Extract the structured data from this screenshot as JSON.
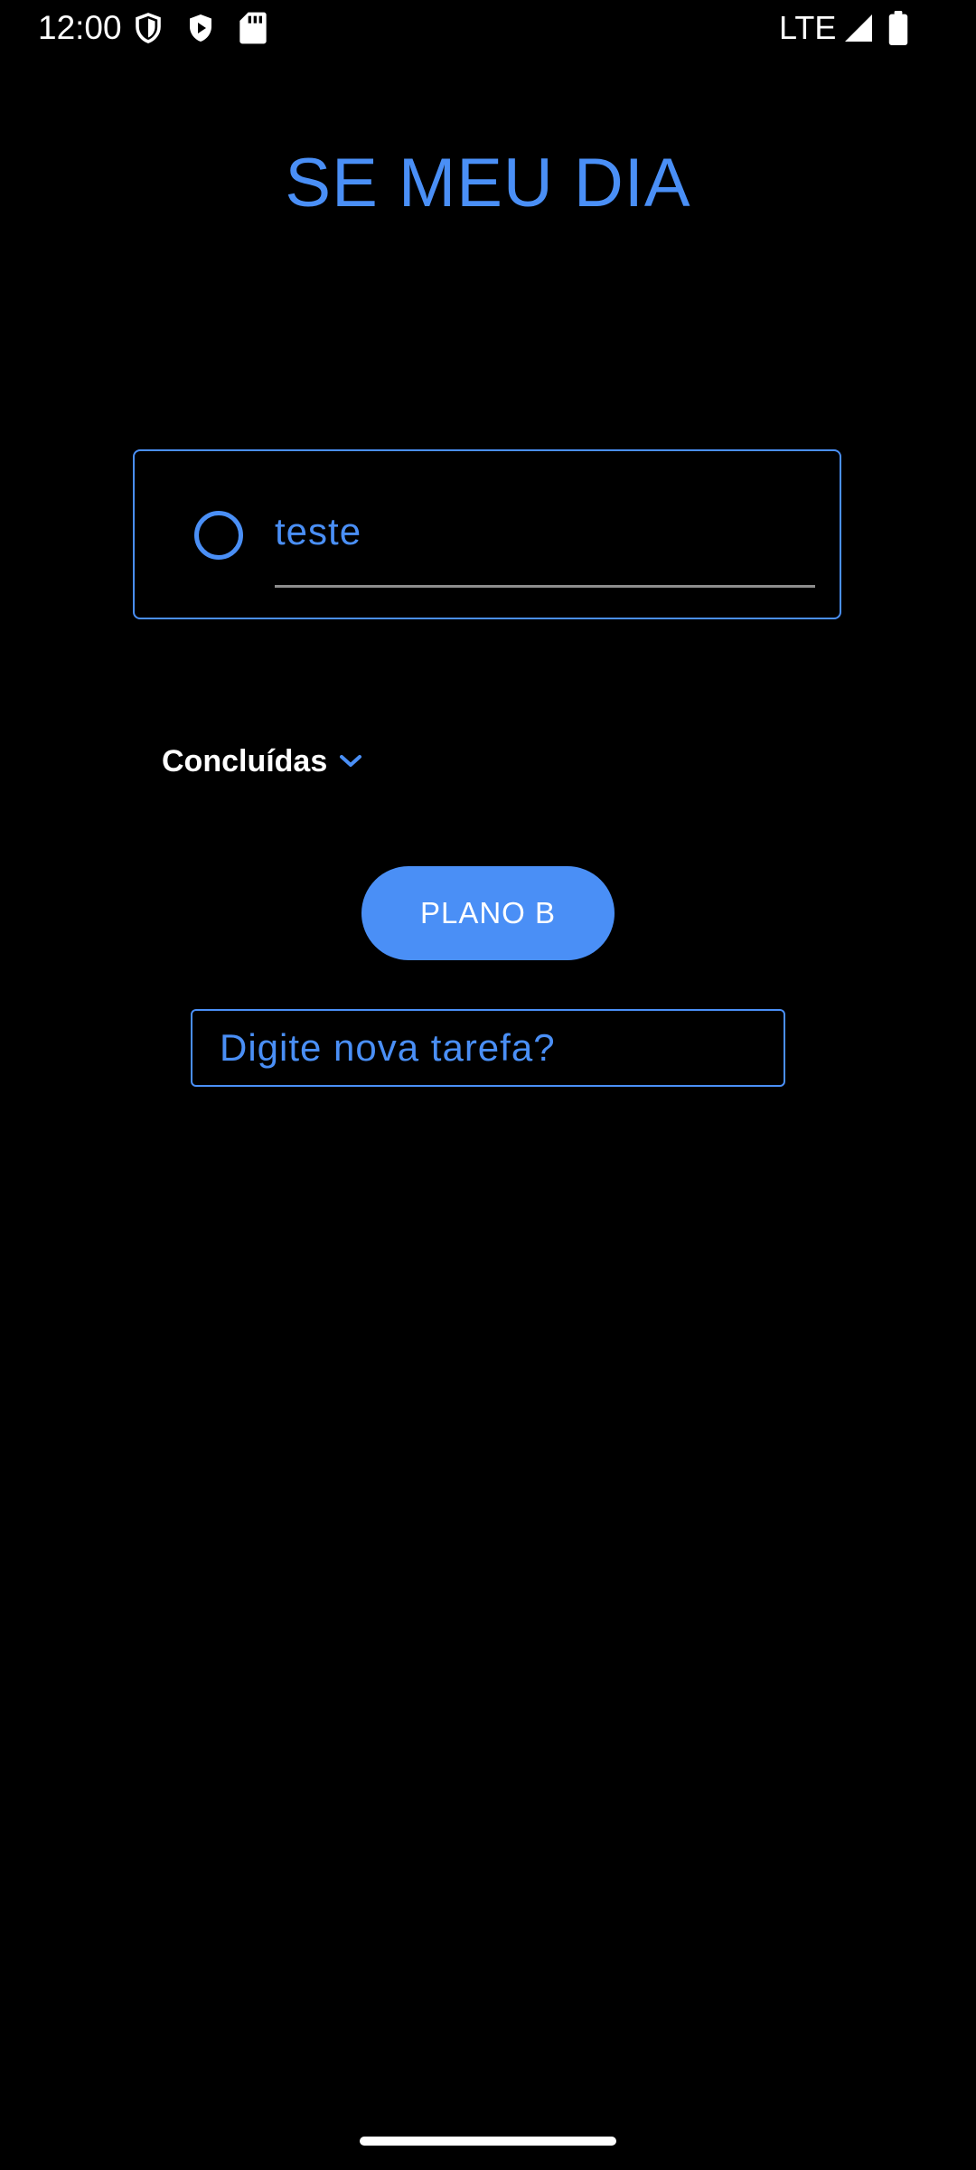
{
  "status_bar": {
    "time": "12:00",
    "network": "LTE",
    "icons": [
      "shield-icon",
      "play-protect-icon",
      "sd-card-icon",
      "signal-icon",
      "battery-icon"
    ]
  },
  "app": {
    "title": "SE MEU DIA"
  },
  "tasks": [
    {
      "text": "teste",
      "completed": false
    }
  ],
  "completed_section": {
    "label": "Concluídas",
    "icon": "chevron-down-icon"
  },
  "plan_b_button": {
    "label": "PLANO B"
  },
  "new_task_input": {
    "placeholder": "Digite nova tarefa?",
    "value": ""
  },
  "colors": {
    "accent": "#4a8ff6",
    "background": "#000000",
    "text": "#ffffff",
    "underline": "#8d8d8d"
  }
}
